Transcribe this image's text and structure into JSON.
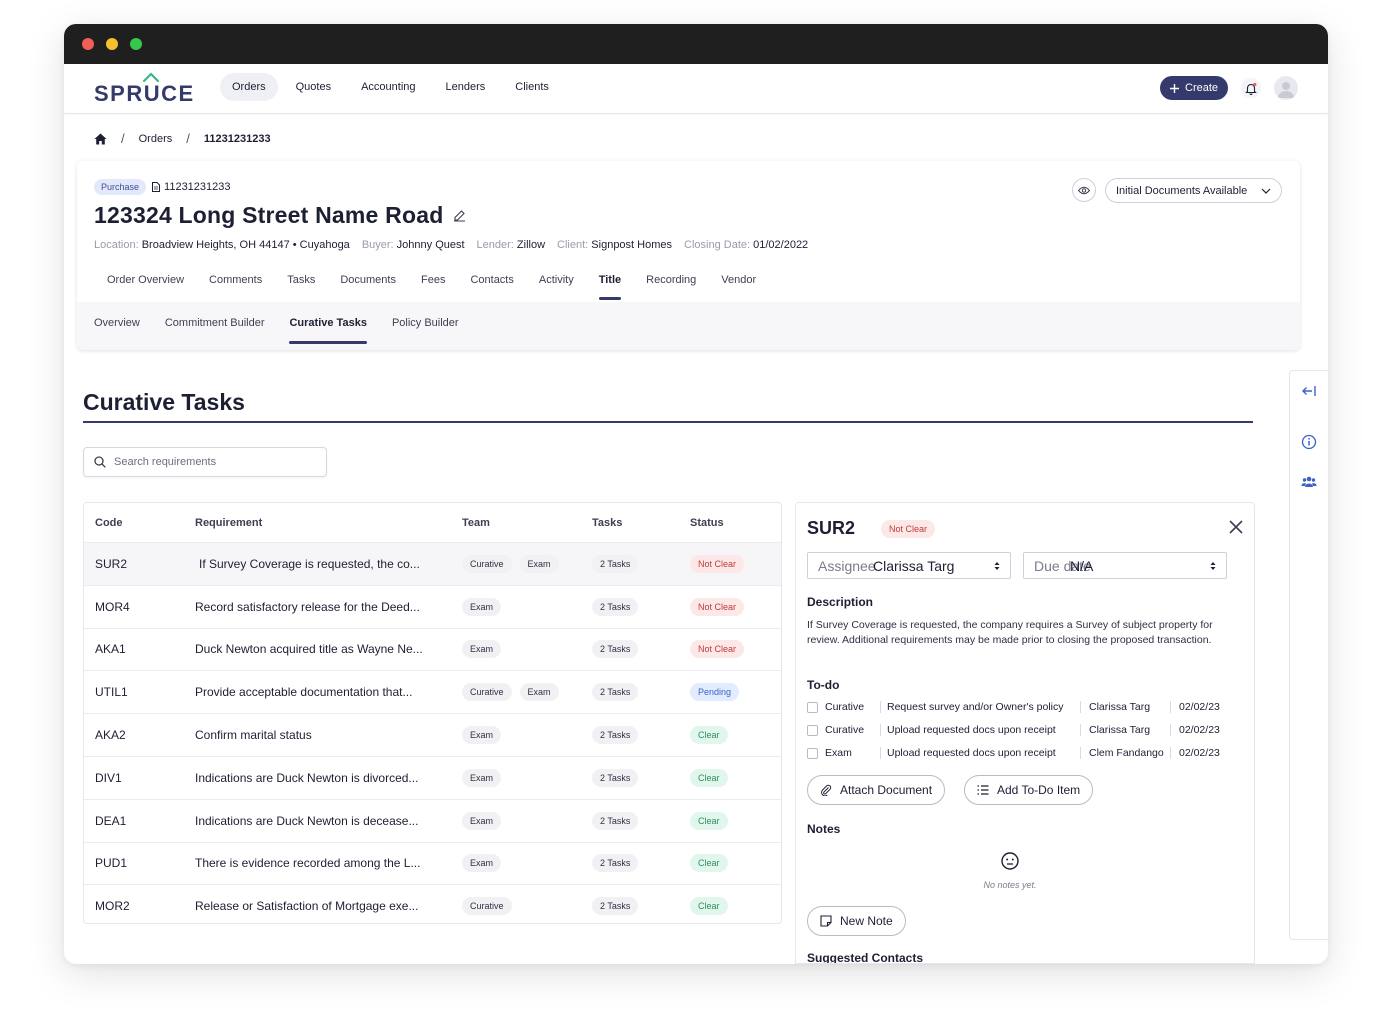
{
  "window": {
    "dots": [
      "#ef5f58",
      "#f6be31",
      "#35c84a"
    ]
  },
  "brand": {
    "name": "SPRUCE",
    "color": "#343a6b",
    "accent": "#39b58a"
  },
  "nav": {
    "items": [
      {
        "label": "Orders",
        "active": true
      },
      {
        "label": "Quotes"
      },
      {
        "label": "Accounting"
      },
      {
        "label": "Lenders"
      },
      {
        "label": "Clients"
      }
    ],
    "create_label": "Create",
    "create_icon": "plus-icon",
    "bell_icon": "bell-icon",
    "avatar_icon": "user-avatar-icon"
  },
  "breadcrumb": {
    "home_icon": "home-icon",
    "items": [
      "Orders",
      "11231231233"
    ]
  },
  "order": {
    "type_badge": "Purchase",
    "number": "11231231233",
    "title": "123324 Long Street Name Road",
    "meta": [
      {
        "label": "Location:",
        "value": "Broadview Heights, OH 44147 • Cuyahoga"
      },
      {
        "label": "Buyer:",
        "value": "Johnny Quest"
      },
      {
        "label": "Lender:",
        "value": "Zillow"
      },
      {
        "label": "Client:",
        "value": "Signpost Homes"
      },
      {
        "label": "Closing Date:",
        "value": "01/02/2022"
      }
    ],
    "status_select": "Initial Documents Available",
    "tabs": [
      "Order Overview",
      "Comments",
      "Tasks",
      "Documents",
      "Fees",
      "Contacts",
      "Activity",
      "Title",
      "Recording",
      "Vendor"
    ],
    "active_tab": "Title",
    "subtabs": [
      "Overview",
      "Commitment Builder",
      "Curative Tasks",
      "Policy Builder"
    ],
    "active_subtab": "Curative Tasks"
  },
  "curative": {
    "title": "Curative Tasks",
    "search_placeholder": "Search requirements",
    "columns": [
      "Code",
      "Requirement",
      "Team",
      "Tasks",
      "Status"
    ],
    "rows": [
      {
        "code": "SUR2",
        "requirement": "If Survey Coverage is requested, the co...",
        "team": [
          "Curative",
          "Exam"
        ],
        "tasks": "2 Tasks",
        "status": "Not Clear",
        "status_kind": "notclear"
      },
      {
        "code": "MOR4",
        "requirement": "Record satisfactory release for the Deed...",
        "team": [
          "Exam"
        ],
        "tasks": "2 Tasks",
        "status": "Not Clear",
        "status_kind": "notclear"
      },
      {
        "code": "AKA1",
        "requirement": "Duck Newton acquired title as Wayne Ne...",
        "team": [
          "Exam"
        ],
        "tasks": "2 Tasks",
        "status": "Not Clear",
        "status_kind": "notclear"
      },
      {
        "code": "UTIL1",
        "requirement": "Provide acceptable documentation that...",
        "team": [
          "Curative",
          "Exam"
        ],
        "tasks": "2 Tasks",
        "status": "Pending",
        "status_kind": "pending"
      },
      {
        "code": "AKA2",
        "requirement": "Confirm marital status",
        "team": [
          "Exam"
        ],
        "tasks": "2 Tasks",
        "status": "Clear",
        "status_kind": "clear"
      },
      {
        "code": "DIV1",
        "requirement": "Indications are Duck Newton is divorced...",
        "team": [
          "Exam"
        ],
        "tasks": "2 Tasks",
        "status": "Clear",
        "status_kind": "clear"
      },
      {
        "code": "DEA1",
        "requirement": "Indications are Duck Newton is decease...",
        "team": [
          "Exam"
        ],
        "tasks": "2 Tasks",
        "status": "Clear",
        "status_kind": "clear"
      },
      {
        "code": "PUD1",
        "requirement": "There is evidence recorded among the L...",
        "team": [
          "Exam"
        ],
        "tasks": "2 Tasks",
        "status": "Clear",
        "status_kind": "clear"
      },
      {
        "code": "MOR2",
        "requirement": "Release or Satisfaction of Mortgage exe...",
        "team": [
          "Curative"
        ],
        "tasks": "2 Tasks",
        "status": "Clear",
        "status_kind": "clear"
      }
    ]
  },
  "detail": {
    "code": "SUR2",
    "status": "Not Clear",
    "assignee_placeholder": "Assignee",
    "assignee_value": "Clarissa Targ",
    "due_placeholder": "Due date",
    "due_value": "N/A",
    "description_label": "Description",
    "description": "If Survey Coverage is requested, the company requires a Survey of subject property for review. Additional requirements may be made prior to closing the proposed transaction.",
    "todo_label": "To-do",
    "todos": [
      {
        "team": "Curative",
        "task": "Request survey and/or Owner's policy",
        "who": "Clarissa Targ",
        "date": "02/02/23"
      },
      {
        "team": "Curative",
        "task": "Upload requested docs upon receipt",
        "who": "Clarissa Targ",
        "date": "02/02/23"
      },
      {
        "team": "Exam",
        "task": "Upload requested docs upon receipt",
        "who": "Clem Fandango",
        "date": "02/02/23"
      }
    ],
    "attach_label": "Attach Document",
    "add_todo_label": "Add To-Do Item",
    "notes_label": "Notes",
    "no_notes": "No notes yet.",
    "new_note_label": "New Note",
    "suggested_label": "Suggested Contacts"
  }
}
